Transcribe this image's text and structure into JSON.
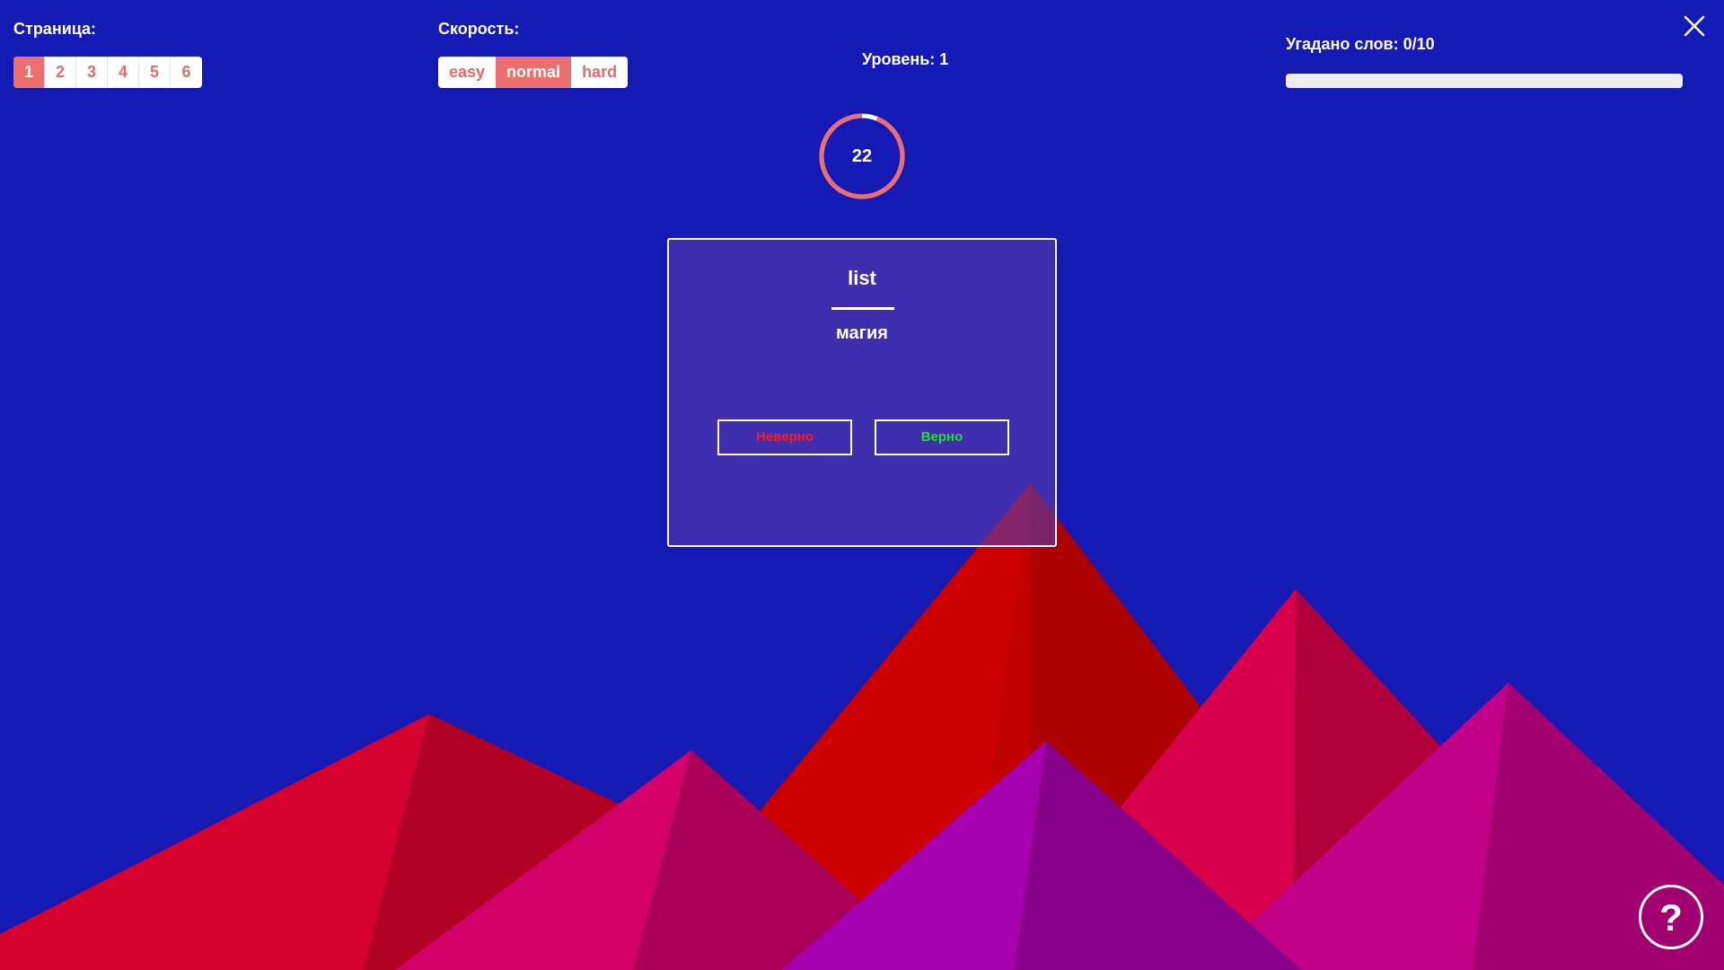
{
  "pages": {
    "label": "Страница:",
    "items": [
      "1",
      "2",
      "3",
      "4",
      "5",
      "6"
    ],
    "active": "1"
  },
  "speed": {
    "label": "Скорость:",
    "items": [
      "easy",
      "normal",
      "hard"
    ],
    "active": "normal"
  },
  "level": {
    "label": "Уровень: 1"
  },
  "progress": {
    "label": "Угадано слов: 0/10",
    "guessed": 0,
    "total": 10
  },
  "timer": {
    "value": "22",
    "remaining_fraction": 0.94
  },
  "card": {
    "word": "list",
    "translation": "магия",
    "wrong_label": "Неверно",
    "right_label": "Верно"
  },
  "help": {
    "label": "?"
  },
  "colors": {
    "background": "#161ab4",
    "accent": "#ec6e6e",
    "wrong": "#ff1a1a",
    "right": "#22e02a"
  },
  "icons": {
    "close": "close-icon",
    "help": "question-icon"
  }
}
